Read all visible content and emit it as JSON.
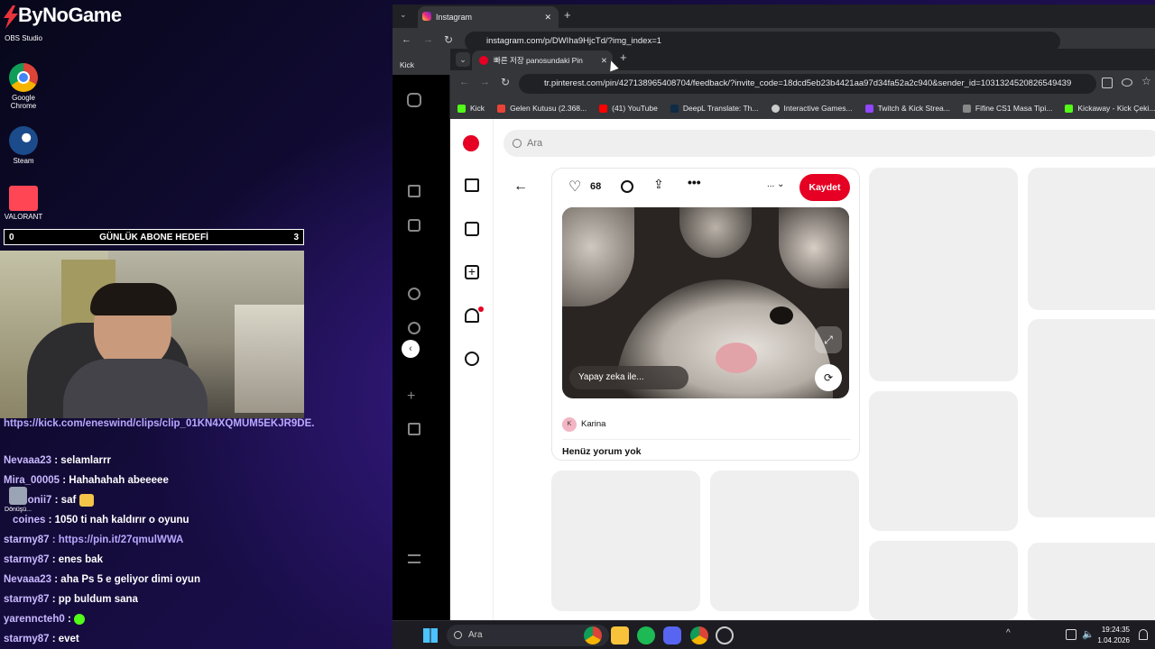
{
  "desktop": {
    "brand": "ByNoGame",
    "icons": [
      {
        "label": "OBS Studio",
        "name": "obs-icon"
      },
      {
        "label": "Google Chrome",
        "name": "chrome-icon"
      },
      {
        "label": "Steam",
        "name": "steam-icon"
      },
      {
        "label": "VALORANT",
        "name": "valorant-icon"
      },
      {
        "label": "Dönüşü...",
        "name": "recycle-bin-icon"
      }
    ]
  },
  "stream": {
    "goal": {
      "left": "0",
      "title": "GÜNLÜK ABONE HEDEFİ",
      "right": "3"
    },
    "chat": [
      {
        "user": "",
        "msg": "https://kick.com/eneswind/clips/clip_01KN4XQMUM5EKJR9DE...CVHS",
        "type": "link"
      },
      {
        "user": "Nevaaa23",
        "msg": ": selamlarrr",
        "type": "text"
      },
      {
        "user": "Mira_00005",
        "msg": ": Hahahahah abeeeee",
        "type": "text"
      },
      {
        "user": "milonii7",
        "msg": ": saf",
        "type": "text"
      },
      {
        "user": "coines",
        "msg": ": 1050 ti nah kaldırır o oyunu",
        "type": "text"
      },
      {
        "user": "starmy87",
        "msg": ": https://pin.it/27qmulWWA",
        "type": "link"
      },
      {
        "user": "starmy87",
        "msg": ": enes bak",
        "type": "text"
      },
      {
        "user": "Nevaaa23",
        "msg": ": aha Ps 5 e geliyor dimi oyun",
        "type": "text"
      },
      {
        "user": "starmy87",
        "msg": ": pp buldum sana",
        "type": "text"
      },
      {
        "user": "yarenncteh0",
        "msg": ":",
        "type": "text"
      },
      {
        "user": "starmy87",
        "msg": ": evet",
        "type": "text"
      }
    ]
  },
  "ig_window": {
    "tab_title": "Instagram",
    "url": "instagram.com/p/DWIha9HjcTd/?img_index=1",
    "bookmark": "Kick"
  },
  "pin_window": {
    "tab_title": "빠른 저장 panosundaki Pin",
    "url": "tr.pinterest.com/pin/427138965408704/feedback/?invite_code=18dcd5eb23b4421aa97d34fa52a2c940&sender_id=1031324520826549439",
    "bookmarks": [
      {
        "label": "Kick",
        "color": "#53fc18"
      },
      {
        "label": "Gelen Kutusu (2.368...",
        "color": "#ea4335"
      },
      {
        "label": "(41) YouTube",
        "color": "#ff0000"
      },
      {
        "label": "DeepL Translate: Th...",
        "color": "#0f2b46"
      },
      {
        "label": "Interactive Games...",
        "color": "#cccccc"
      },
      {
        "label": "Twitch & Kick Strea...",
        "color": "#9146ff"
      },
      {
        "label": "Fifine CS1 Masa Tipi...",
        "color": "#888888"
      },
      {
        "label": "Kickaway - Kick Çeki...",
        "color": "#53fc18"
      }
    ],
    "search_placeholder": "Ara",
    "pin": {
      "likes": "68",
      "save_label": "Kaydet",
      "ai_label": "Yapay zeka ile...",
      "author": "Karina",
      "author_initial": "K",
      "comments_heading": "Henüz yorum yok",
      "more_dots": "..."
    }
  },
  "taskbar": {
    "search_placeholder": "Ara",
    "time": "19:24:35",
    "date": "1.04.2026"
  },
  "colors": {
    "pinterest_red": "#e60023",
    "chat_user": "#c9b8ff"
  }
}
